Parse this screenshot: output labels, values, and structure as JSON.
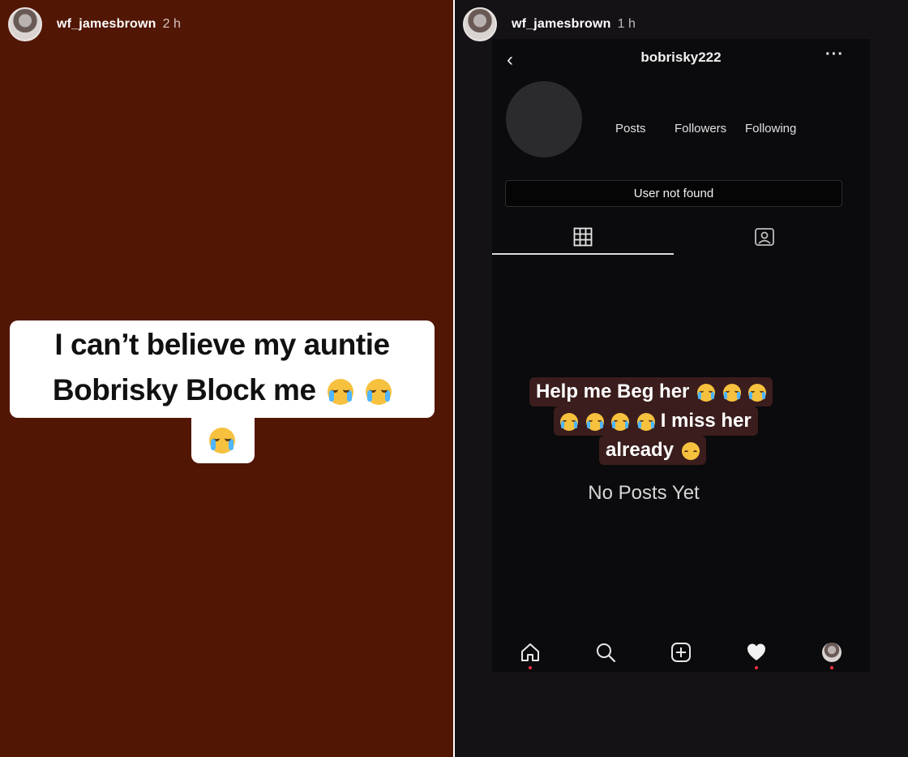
{
  "left_story": {
    "username": "wf_jamesbrown",
    "time_ago": "2 h",
    "caption_line1": "I can’t believe my auntie",
    "caption_line2": "Bobrisky Block me",
    "caption_emoji": "loudly-crying-face",
    "background_color": "#521604"
  },
  "right_story": {
    "username": "wf_jamesbrown",
    "time_ago": "1 h",
    "profile": {
      "username": "bobrisky222",
      "stats": {
        "posts_label": "Posts",
        "followers_label": "Followers",
        "following_label": "Following"
      },
      "status_message": "User not found",
      "tabs": [
        {
          "icon": "grid-icon",
          "active": true
        },
        {
          "icon": "tagged-icon",
          "active": false
        }
      ],
      "empty_state": "No Posts Yet"
    },
    "overlay_text": {
      "line1": "Help me Beg her",
      "line2": "I miss her",
      "line3": "already"
    },
    "bottom_nav": [
      "home-icon",
      "search-icon",
      "new-post-icon",
      "activity-heart-icon",
      "profile-avatar"
    ]
  },
  "colors": {
    "left_background": "#521604",
    "right_background": "#141215",
    "highlight_background": "#3a1d1c",
    "notification_dot": "#ff3040",
    "emoji_yellow": "#f6c13e",
    "tear_blue": "#4fb6ff"
  }
}
